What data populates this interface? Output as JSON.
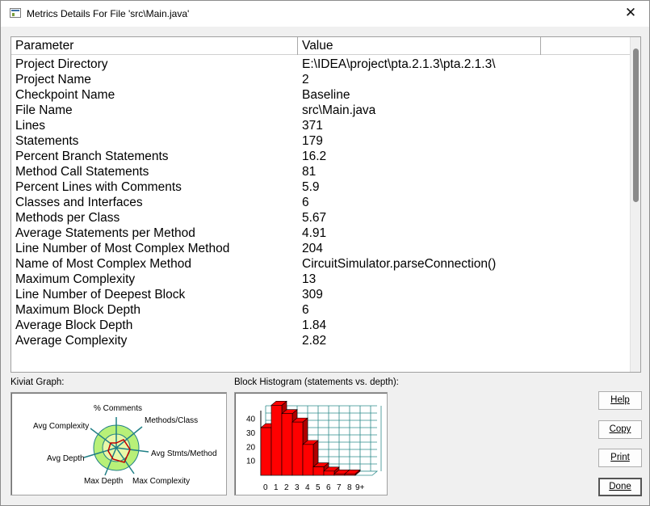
{
  "window": {
    "title": "Metrics Details For File 'src\\Main.java'",
    "close_glyph": "✕"
  },
  "metrics": {
    "columns": [
      "Parameter",
      "Value",
      ""
    ],
    "rows": [
      {
        "param": "Project Directory",
        "value": "E:\\IDEA\\project\\pta.2.1.3\\pta.2.1.3\\"
      },
      {
        "param": "Project Name",
        "value": "2"
      },
      {
        "param": "Checkpoint Name",
        "value": "Baseline"
      },
      {
        "param": "File Name",
        "value": "src\\Main.java"
      },
      {
        "param": "Lines",
        "value": "371"
      },
      {
        "param": "Statements",
        "value": "179"
      },
      {
        "param": "Percent Branch Statements",
        "value": "16.2"
      },
      {
        "param": "Method Call Statements",
        "value": "81"
      },
      {
        "param": "Percent Lines with Comments",
        "value": "5.9"
      },
      {
        "param": "Classes and Interfaces",
        "value": "6"
      },
      {
        "param": "Methods per Class",
        "value": "5.67"
      },
      {
        "param": "Average Statements per Method",
        "value": "4.91"
      },
      {
        "param": "Line Number of Most Complex Method",
        "value": "204"
      },
      {
        "param": "Name of Most Complex Method",
        "value": "CircuitSimulator.parseConnection()"
      },
      {
        "param": "Maximum Complexity",
        "value": "13"
      },
      {
        "param": "Line Number of Deepest Block",
        "value": "309"
      },
      {
        "param": "Maximum Block Depth",
        "value": "6"
      },
      {
        "param": "Average Block Depth",
        "value": "1.84"
      },
      {
        "param": "Average Complexity",
        "value": "2.82"
      }
    ]
  },
  "kiviat": {
    "label": "Kiviat Graph:",
    "axes": {
      "comments": "% Comments",
      "methods_class": "Methods/Class",
      "avg_stmts": "Avg Stmts/Method",
      "max_complexity": "Max Complexity",
      "max_depth": "Max Depth",
      "avg_depth": "Avg Depth",
      "avg_complexity": "Avg Complexity"
    },
    "colors": {
      "outer_ring": "#b8f078",
      "inner_ring": "#e8f8a8",
      "spoke": "#1f7f86",
      "data": "#c00000"
    }
  },
  "histogram": {
    "label": "Block Histogram (statements vs. depth):",
    "colors": {
      "bar": "#ff0000",
      "bar_side": "#b00000",
      "grid": "#2e8b8b"
    },
    "chart_data": {
      "type": "bar",
      "categories": [
        "0",
        "1",
        "2",
        "3",
        "4",
        "5",
        "6",
        "7",
        "8",
        "9+"
      ],
      "values": [
        34,
        50,
        44,
        38,
        22,
        6,
        3,
        1,
        1,
        0
      ],
      "ylim": [
        0,
        45
      ],
      "yticks": [
        "40",
        "30",
        "20",
        "10"
      ]
    }
  },
  "buttons": {
    "help": "Help",
    "copy": "Copy",
    "print": "Print",
    "done": "Done"
  }
}
